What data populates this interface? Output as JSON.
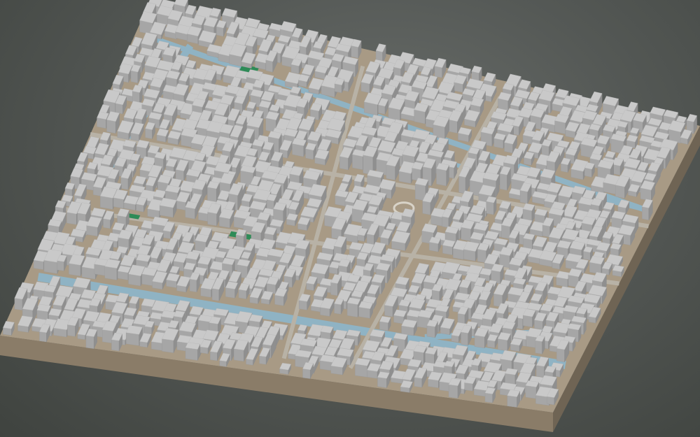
{
  "scene": {
    "subject": "3d-city-block-model",
    "colors": {
      "background_light": "#6a6e6b",
      "background_dark": "#3f433f",
      "base_top": "#a89a85",
      "base_side": "#8a7c68",
      "base_side_dark": "#6f6454",
      "building_top": "#c9c9c9",
      "building_left": "#a6a6a6",
      "building_right": "#8f8f8f",
      "water": "#8fb3c4",
      "street": "#b8b2a6",
      "park": "#2e8b57",
      "plaza_ring": "#d8d3c8"
    }
  }
}
